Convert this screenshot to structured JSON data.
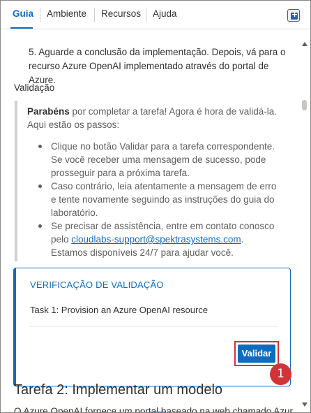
{
  "tabs": [
    {
      "label": "Guia",
      "active": true
    },
    {
      "label": "Ambiente",
      "active": false
    },
    {
      "label": "Recursos",
      "active": false
    },
    {
      "label": "Ajuda",
      "active": false
    }
  ],
  "corner_button_icon": "add-square-icon",
  "instructions": {
    "step5": "5. Aguarde a conclusão da implementação. Depois, vá para o recurso Azure OpenAI implementado através do portal de Azure.",
    "validation_heading": "Validação"
  },
  "quote": {
    "bold": "Parabéns",
    "text": " por completar a tarefa! Agora é hora de validá-la. Aqui estão os passos:",
    "bullets": [
      "Clique no botão Validar para a tarefa correspondente. Se você receber uma mensagem de sucesso, pode prosseguir para a próxima tarefa.",
      "Caso contrário, leia atentamente a mensagem de erro e tente novamente seguindo as instruções do guia do laboratório."
    ],
    "bullet3_before": "Se precisar de assistência, entre em contato conosco pelo ",
    "bullet3_link": "cloudlabs-support@spektrasystems.com",
    "bullet3_after": ". Estamos disponíveis 24/7 para ajudar você."
  },
  "validation_card": {
    "title": "VERIFICAÇÃO DE VALIDAÇÃO",
    "task": "Task 1: Provision an Azure OpenAI resource",
    "button_label": "Validar",
    "callout_number": "1"
  },
  "next_section": {
    "heading": "Tarefa 2: Implementar um modelo",
    "paragraph": "O Azure OpenAI fornece um portal baseado na web chamado Azure AI"
  },
  "colors": {
    "accent": "#0f6cbd",
    "callout": "#d13438"
  }
}
